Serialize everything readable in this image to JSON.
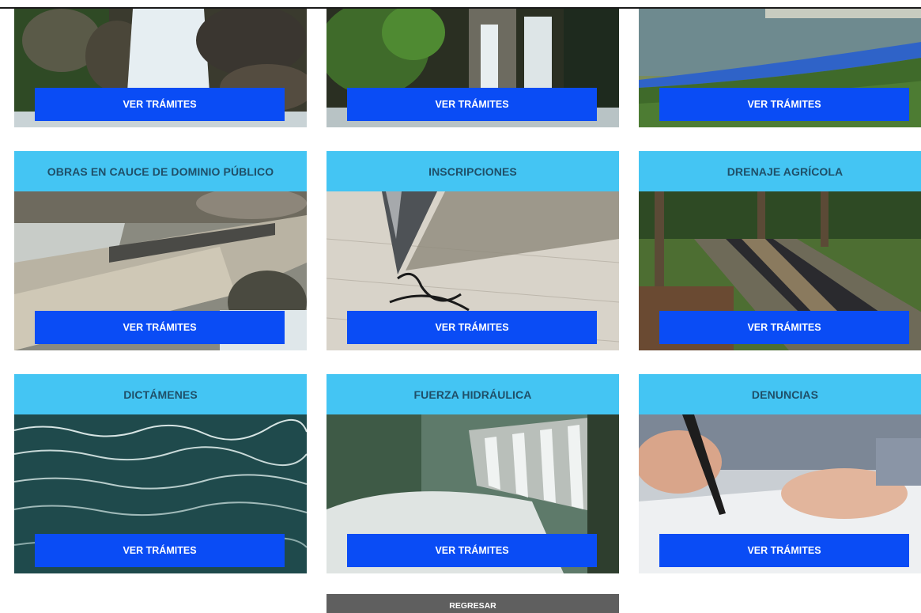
{
  "buttons": {
    "ver_tramites": "VER TRÁMITES",
    "regresar": "REGRESAR"
  },
  "cards": [
    {
      "title": ""
    },
    {
      "title": ""
    },
    {
      "title": ""
    },
    {
      "title": "OBRAS EN CAUCE DE DOMINIO PÚBLICO"
    },
    {
      "title": "INSCRIPCIONES"
    },
    {
      "title": "DRENAJE AGRÍCOLA"
    },
    {
      "title": "DICTÁMENES"
    },
    {
      "title": "FUERZA HIDRÁULICA"
    },
    {
      "title": "DENUNCIAS"
    }
  ],
  "colors": {
    "title_bar": "#44c5f3",
    "button": "#0a4cf5",
    "back_button": "#5f5f5f"
  }
}
